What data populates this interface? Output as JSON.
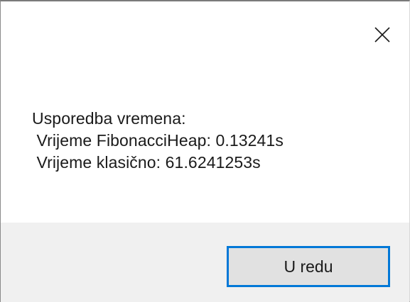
{
  "dialog": {
    "close_icon": "close-x-icon",
    "message_lines": [
      "Usporedba vremena:",
      " Vrijeme FibonacciHeap: 0.13241s",
      " Vrijeme klasično: 61.6241253s"
    ],
    "ok_label": "U redu"
  },
  "colors": {
    "accent": "#0078d7",
    "footer_bg": "#f0f0f0",
    "button_bg": "#e1e1e1",
    "text": "#1a1a1a"
  }
}
